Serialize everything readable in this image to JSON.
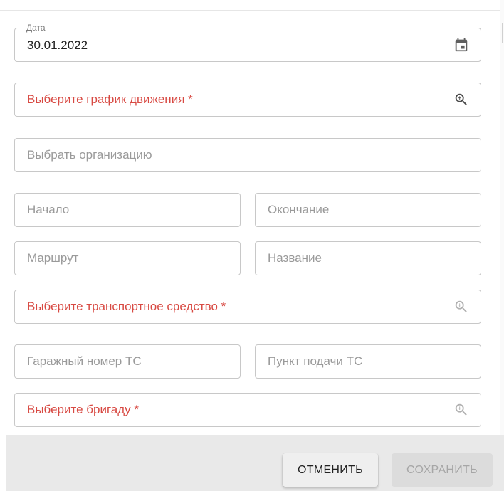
{
  "date_field": {
    "label": "Дата",
    "value": "30.01.2022",
    "icon": "calendar-icon"
  },
  "schedule_field": {
    "placeholder": "Выберите график движения *",
    "icon": "zoom-in-icon"
  },
  "organization_field": {
    "placeholder": "Выбрать организацию"
  },
  "start_field": {
    "placeholder": "Начало"
  },
  "end_field": {
    "placeholder": "Окончание"
  },
  "route_field": {
    "placeholder": "Маршрут"
  },
  "name_field": {
    "placeholder": "Название"
  },
  "vehicle_field": {
    "placeholder": "Выберите транспортное средство *",
    "icon": "zoom-in-icon"
  },
  "garage_number_field": {
    "placeholder": "Гаражный номер ТС"
  },
  "dispatch_point_field": {
    "placeholder": "Пункт подачи ТС"
  },
  "brigade_field": {
    "placeholder": "Выберите бригаду *",
    "icon": "zoom-in-icon"
  },
  "footer": {
    "cancel_label": "ОТМЕНИТЬ",
    "save_label": "СОХРАНИТЬ"
  },
  "colors": {
    "required": "#d84a43",
    "placeholder": "#9a9a9a",
    "border": "#c8c8c8",
    "footer_bg": "#e9e9e9"
  }
}
